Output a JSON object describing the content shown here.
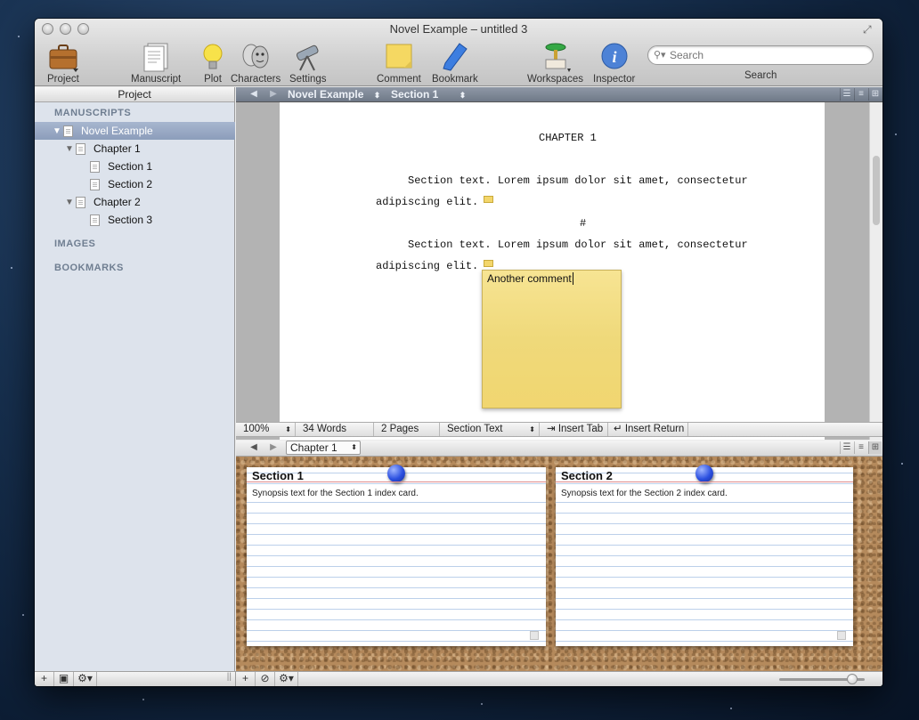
{
  "window": {
    "title": "Novel Example – untitled 3"
  },
  "toolbar": {
    "project": "Project",
    "manuscript": "Manuscript",
    "plot": "Plot",
    "characters": "Characters",
    "settings": "Settings",
    "comment": "Comment",
    "bookmark": "Bookmark",
    "workspaces": "Workspaces",
    "inspector": "Inspector",
    "search_placeholder": "Search",
    "search_label": "Search"
  },
  "binder": {
    "header": "Project",
    "sections": {
      "manuscripts": "MANUSCRIPTS",
      "images": "IMAGES",
      "bookmarks": "BOOKMARKS"
    },
    "items": [
      {
        "label": "Novel Example"
      },
      {
        "label": "Chapter 1"
      },
      {
        "label": "Section 1"
      },
      {
        "label": "Section 2"
      },
      {
        "label": "Chapter 2"
      },
      {
        "label": "Section 3"
      }
    ]
  },
  "editor": {
    "nav": {
      "document": "Novel Example",
      "section": "Section 1"
    },
    "heading": "CHAPTER 1",
    "para1_line1": "Section text. Lorem ipsum dolor sit amet, consectetur",
    "para1_line2": "adipiscing elit.",
    "separator": "#",
    "para2_line1": "Section text. Lorem ipsum dolor sit amet, consectetur",
    "para2_line2": "adipiscing elit.",
    "comment_text": "Another comment"
  },
  "footer": {
    "zoom": "100%",
    "words": "34 Words",
    "pages": "2 Pages",
    "style": "Section Text",
    "insert_tab": "Insert Tab",
    "insert_return": "Insert Return"
  },
  "corkboard": {
    "nav": {
      "chapter": "Chapter 1"
    },
    "cards": [
      {
        "title": "Section 1",
        "synopsis": "Synopsis text for the Section 1 index card."
      },
      {
        "title": "Section 2",
        "synopsis": "Synopsis text for the Section 2 index card."
      }
    ]
  },
  "colors": {
    "accent": "#8c9dbb",
    "sticky": "#efd97a",
    "cork": "#b58a5c",
    "pin": "#2a4fe0"
  },
  "icons": [
    "briefcase-icon",
    "manuscript-icon",
    "lightbulb-icon",
    "masks-icon",
    "telescope-icon",
    "note-icon",
    "bookmark-icon",
    "workspaces-icon",
    "inspector-icon",
    "search-icon"
  ]
}
